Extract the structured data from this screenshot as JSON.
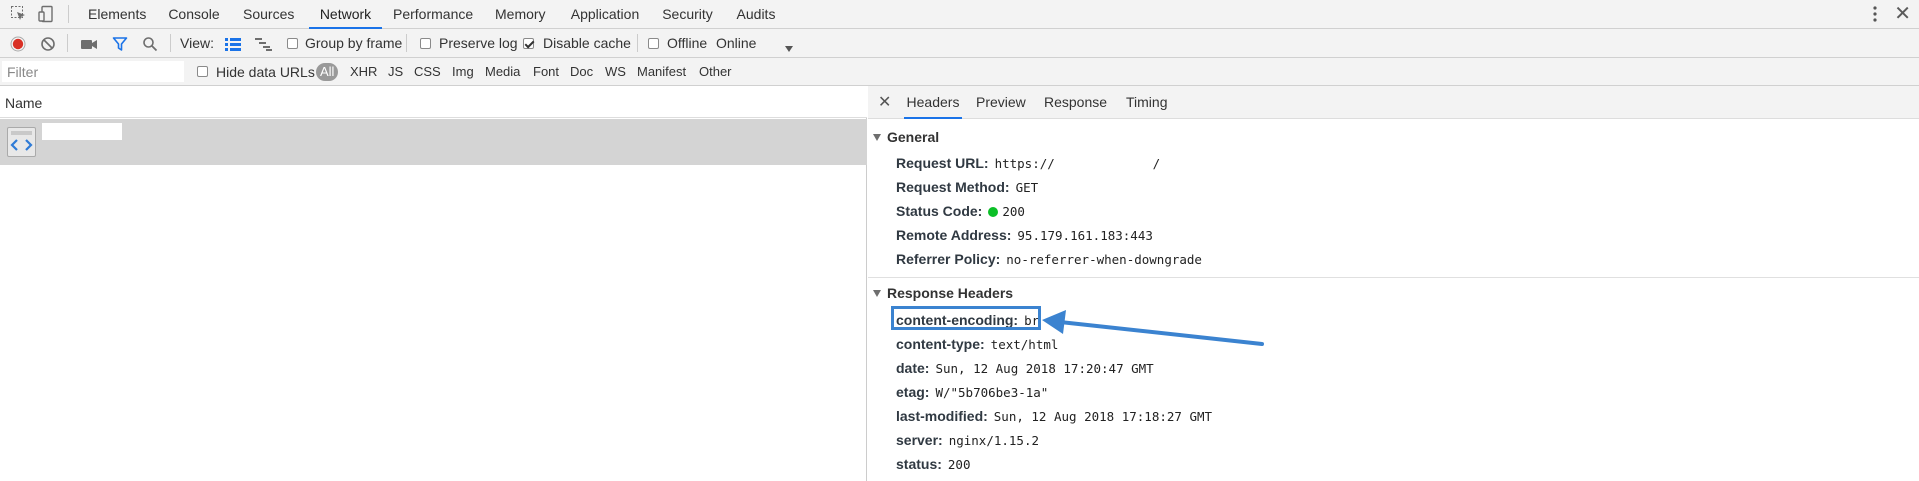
{
  "tabs": [
    "Elements",
    "Console",
    "Sources",
    "Network",
    "Performance",
    "Memory",
    "Application",
    "Security",
    "Audits"
  ],
  "active_tab": "Network",
  "toolbar": {
    "view_label": "View:",
    "group_by_frame": "Group by frame",
    "preserve_log": "Preserve log",
    "disable_cache": "Disable cache",
    "offline": "Offline",
    "throttle": "Online"
  },
  "filter": {
    "placeholder": "Filter",
    "hide_data_urls": "Hide data URLs",
    "types": [
      "All",
      "XHR",
      "JS",
      "CSS",
      "Img",
      "Media",
      "Font",
      "Doc",
      "WS",
      "Manifest",
      "Other"
    ]
  },
  "requests": {
    "column_name": "Name"
  },
  "detail_tabs": [
    "Headers",
    "Preview",
    "Response",
    "Timing"
  ],
  "general": {
    "title": "General",
    "rows": [
      {
        "key": "Request URL:",
        "value": "https://             /"
      },
      {
        "key": "Request Method:",
        "value": "GET"
      },
      {
        "key": "Status Code:",
        "value": "200"
      },
      {
        "key": "Remote Address:",
        "value": "95.179.161.183:443"
      },
      {
        "key": "Referrer Policy:",
        "value": "no-referrer-when-downgrade"
      }
    ]
  },
  "response_headers": {
    "title": "Response Headers",
    "rows": [
      {
        "key": "content-encoding:",
        "value": "br"
      },
      {
        "key": "content-type:",
        "value": "text/html"
      },
      {
        "key": "date:",
        "value": "Sun, 12 Aug 2018 17:20:47 GMT"
      },
      {
        "key": "etag:",
        "value": "W/\"5b706be3-1a\""
      },
      {
        "key": "last-modified:",
        "value": "Sun, 12 Aug 2018 17:18:27 GMT"
      },
      {
        "key": "server:",
        "value": "nginx/1.15.2"
      },
      {
        "key": "status:",
        "value": "200"
      }
    ]
  },
  "colors": {
    "accent": "#1a73e8",
    "record": "#d93025",
    "status_ok": "#0bbf27",
    "annotation": "#3b83d0"
  }
}
